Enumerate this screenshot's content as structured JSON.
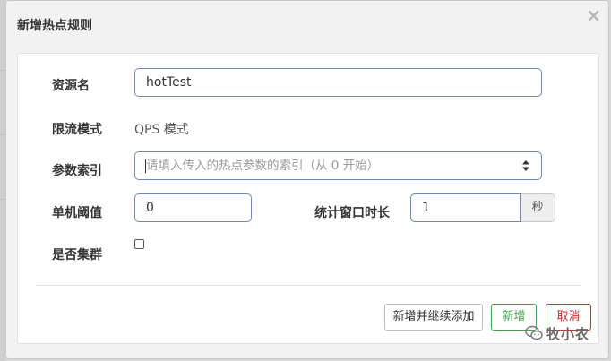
{
  "dialog": {
    "title": "新增热点规则",
    "close_glyph": "×"
  },
  "form": {
    "resource_name": {
      "label": "资源名",
      "value": "hotTest"
    },
    "flow_mode": {
      "label": "限流模式",
      "value": "QPS 模式"
    },
    "param_index": {
      "label": "参数索引",
      "placeholder": "请填入传入的热点参数的索引（从 0 开始）"
    },
    "threshold": {
      "label": "单机阈值",
      "value": "0"
    },
    "window": {
      "label": "统计窗口时长",
      "value": "1",
      "unit": "秒"
    },
    "cluster": {
      "label": "是否集群",
      "checked": false
    }
  },
  "footer": {
    "add_continue_label": "新增并继续添加",
    "add_label": "新增",
    "cancel_label": "取消"
  },
  "watermark": {
    "text": "牧小农",
    "icon": "wechat-icon"
  },
  "colors": {
    "success": "#3fa54a",
    "danger": "#c9302c",
    "input_border": "#6a8bb3"
  }
}
